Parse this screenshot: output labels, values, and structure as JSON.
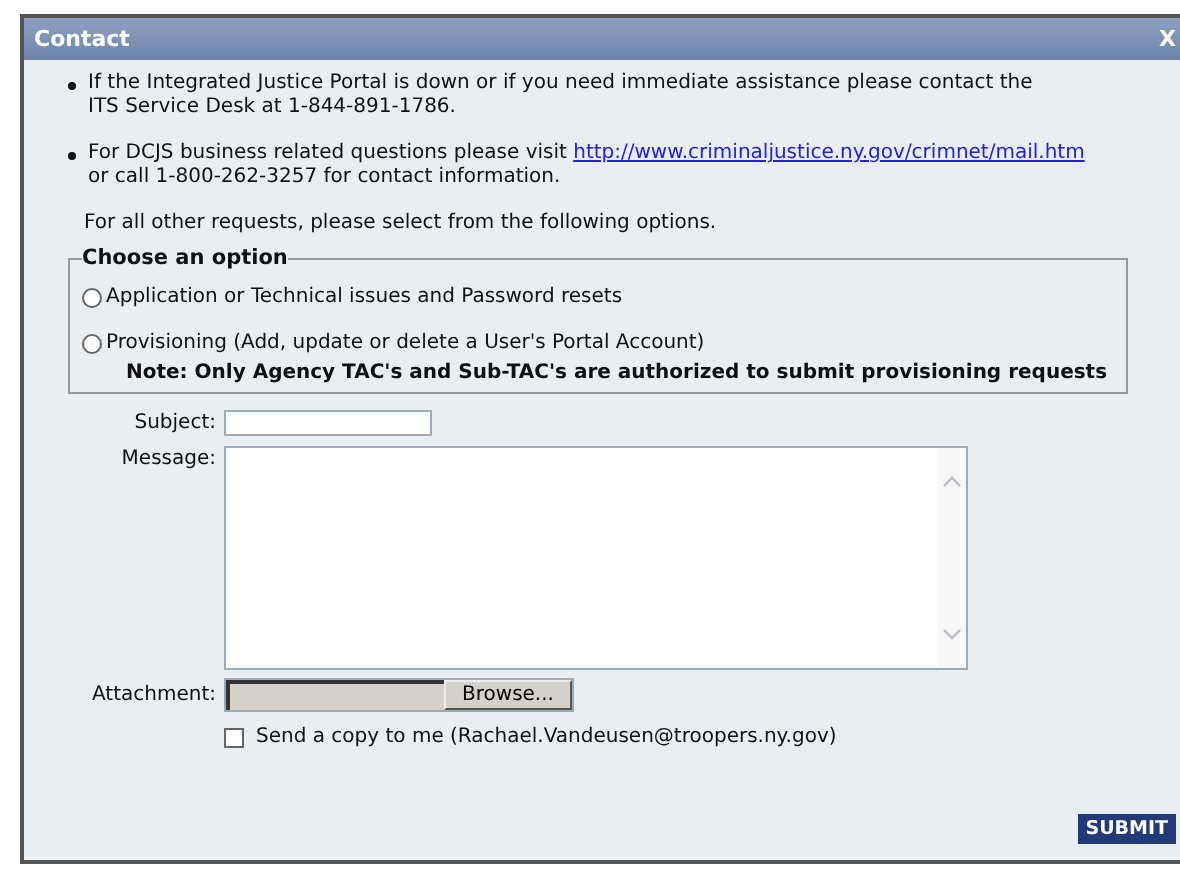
{
  "window": {
    "title": "Contact",
    "close": "X"
  },
  "notices": [
    {
      "text": "If the Integrated Justice Portal is down or if you need immediate assistance please contact the ITS Service Desk at 1-844-891-1786."
    },
    {
      "text": "For DCJS business related questions please visit ",
      "link": "http://www.criminaljustice.ny.gov/crimnet/mail.htm",
      "after": " or call 1-800-262-3257 for contact information."
    }
  ],
  "intro": "For all other requests, please select from the following options.",
  "option_group": {
    "legend": "Choose an option",
    "options": [
      {
        "label": "Application or Technical issues and Password resets",
        "selected": false
      },
      {
        "label": "Provisioning (Add, update or delete a User's Portal Account)",
        "selected": false
      }
    ],
    "note": "Note: Only Agency TAC's and Sub-TAC's are authorized to submit provisioning requests"
  },
  "form": {
    "subject_label": "Subject:",
    "message_label": "Message:",
    "attachment_label": "Attachment:",
    "browse": "Browse...",
    "copy": {
      "label": "Send a copy to me (Rachael.Vandeusen@troopers.ny.gov)",
      "checked": false
    },
    "submit": "SUBMIT"
  }
}
